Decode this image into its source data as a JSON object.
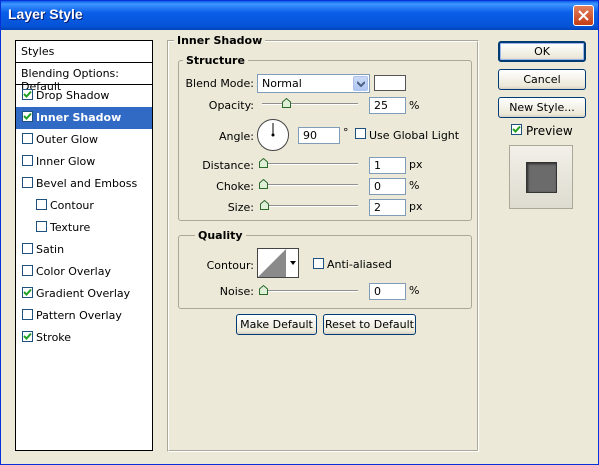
{
  "window": {
    "title": "Layer Style"
  },
  "style_list": {
    "header": "Styles",
    "blending": "Blending Options: Default",
    "items": [
      {
        "label": "Drop Shadow",
        "checked": true,
        "selected": false,
        "indent": false
      },
      {
        "label": "Inner Shadow",
        "checked": true,
        "selected": true,
        "indent": false
      },
      {
        "label": "Outer Glow",
        "checked": false,
        "selected": false,
        "indent": false
      },
      {
        "label": "Inner Glow",
        "checked": false,
        "selected": false,
        "indent": false
      },
      {
        "label": "Bevel and Emboss",
        "checked": false,
        "selected": false,
        "indent": false
      },
      {
        "label": "Contour",
        "checked": false,
        "selected": false,
        "indent": true
      },
      {
        "label": "Texture",
        "checked": false,
        "selected": false,
        "indent": true
      },
      {
        "label": "Satin",
        "checked": false,
        "selected": false,
        "indent": false
      },
      {
        "label": "Color Overlay",
        "checked": false,
        "selected": false,
        "indent": false
      },
      {
        "label": "Gradient Overlay",
        "checked": true,
        "selected": false,
        "indent": false
      },
      {
        "label": "Pattern Overlay",
        "checked": false,
        "selected": false,
        "indent": false
      },
      {
        "label": "Stroke",
        "checked": true,
        "selected": false,
        "indent": false
      }
    ]
  },
  "panel": {
    "title": "Inner Shadow",
    "structure": {
      "title": "Structure",
      "blend_mode_label": "Blend Mode:",
      "blend_mode_value": "Normal",
      "shadow_color": "#ffffff",
      "opacity_label": "Opacity:",
      "opacity_value": "25",
      "opacity_unit": "%",
      "opacity_fraction": 0.25,
      "angle_label": "Angle:",
      "angle_value": "90",
      "angle_unit": "°",
      "use_global_light_label": "Use Global Light",
      "use_global_light": false,
      "distance_label": "Distance:",
      "distance_value": "1",
      "distance_unit": "px",
      "choke_label": "Choke:",
      "choke_value": "0",
      "choke_unit": "%",
      "size_label": "Size:",
      "size_value": "2",
      "size_unit": "px"
    },
    "quality": {
      "title": "Quality",
      "contour_label": "Contour:",
      "anti_aliased_label": "Anti-aliased",
      "anti_aliased": false,
      "noise_label": "Noise:",
      "noise_value": "0",
      "noise_unit": "%"
    },
    "make_default": "Make Default",
    "reset_default": "Reset to Default"
  },
  "buttons": {
    "ok": "OK",
    "cancel": "Cancel",
    "new_style": "New Style...",
    "preview_label": "Preview",
    "preview_checked": true
  },
  "colors": {
    "titlebar": "#0a5ee8",
    "selection": "#316ac5",
    "dialog_bg": "#ECE9D8",
    "check": "#21a121"
  }
}
